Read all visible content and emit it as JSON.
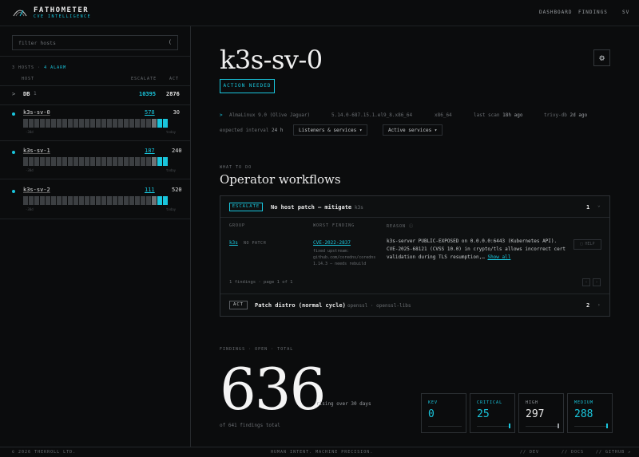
{
  "brand": {
    "name": "FATHOMETER",
    "tagline": "CVE INTELLIGENCE"
  },
  "nav": {
    "dashboard": "DASHBOARD",
    "findings": "FINDINGS",
    "user": "SV"
  },
  "sidebar": {
    "filter_placeholder": "filter hosts",
    "filter_icon": "(",
    "meta_hosts": "3 HOSTS",
    "meta_sep": "·",
    "meta_alarm": "4 ALARM",
    "col_host": "HOST",
    "col_escalate": "ESCALATE",
    "col_act": "ACT",
    "db_row": {
      "chevron": ">",
      "name": "DB",
      "count": "1",
      "escalate": "10395",
      "act": "2876"
    },
    "hosts": [
      {
        "name": "k3s-sv-0",
        "escalate": "578",
        "act": "30",
        "ax_left": "-30d",
        "ax_right": "today"
      },
      {
        "name": "k3s-sv-1",
        "escalate": "187",
        "act": "240",
        "ax_left": "-30d",
        "ax_right": "today"
      },
      {
        "name": "k3s-sv-2",
        "escalate": "111",
        "act": "520",
        "ax_left": "-30d",
        "ax_right": "today"
      }
    ]
  },
  "main": {
    "title": "k3s-sv-0",
    "status_badge": "ACTION NEEDED",
    "sys": {
      "chevron": ">",
      "os": "AlmaLinux 9.0 (Olive Jaguar)",
      "kernel": "5.14.0-687.15.1.el9_8.x86_64",
      "arch": "x86_64",
      "last_scan_label": "last scan",
      "last_scan": "18h ago",
      "trivy_label": "trivy-db",
      "trivy": "2d ago",
      "interval_label": "expected interval",
      "interval": "24 h",
      "dropdown_listeners": "Listeners & services ▾",
      "dropdown_active": "Active services ▾"
    },
    "what_to_do_label": "WHAT TO DO",
    "workflows_title": "Operator workflows",
    "escalate_card": {
      "tag": "ESCALATE",
      "title": "No host patch — mitigate",
      "host": "k3s",
      "count": "1",
      "chevron": "⌄",
      "col_group": "GROUP",
      "col_worst": "WORST FINDING",
      "col_reason": "REASON ⓘ",
      "group_name": "k3s",
      "group_note": "NO PATCH",
      "cve": "CVE-2022-2837",
      "fix_lines": [
        "fixed upstream:",
        "github.com/coredns/coredns",
        "1.14.3 — needs rebuild"
      ],
      "reason_lines": [
        "k3s-server PUBLIC-EXPOSED on 0.0.0.0:6443 (Kubernetes API).",
        "CVE-2025-68121 (CVSS 10.0) in crypto/tls allows incorrect cert",
        "validation during TLS resumption,…"
      ],
      "show_all": "Show all",
      "help": "□ HELP",
      "pagination": "1 findings · page 1 of 1",
      "prev": "‹",
      "next": "›"
    },
    "act_card": {
      "tag": "ACT",
      "title": "Patch distro (normal cycle)",
      "sub": "openssl · openssl-libs",
      "count": "2",
      "chevron": "›"
    },
    "findings_label": "FINDINGS · OPEN · TOTAL",
    "open_count": "636",
    "rising": "rising over 30 days",
    "total_text": "of 641 findings total",
    "stats": [
      {
        "label": "KEV",
        "value": "0",
        "color": "#19c6dd"
      },
      {
        "label": "CRITICAL",
        "value": "25",
        "color": "#19c6dd"
      },
      {
        "label": "HIGH",
        "value": "297",
        "color": "#e8e8e8"
      },
      {
        "label": "MEDIUM",
        "value": "288",
        "color": "#19c6dd"
      }
    ]
  },
  "footer": {
    "copyright": "© 2026 THEKROLL LTD.",
    "motto": "HUMAN INTENT. MACHINE PRECISION.",
    "dev": "// DEV",
    "docs": "// DOCS",
    "github": "// GITHUB ↗"
  },
  "colors": {
    "accent": "#19c6dd",
    "background": "#0b0c0d"
  }
}
